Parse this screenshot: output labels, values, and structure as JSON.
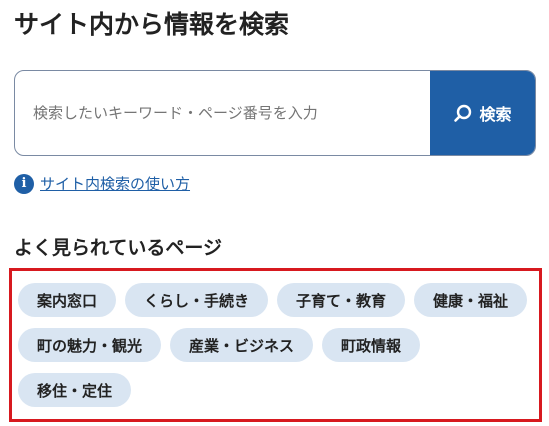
{
  "page": {
    "title": "サイト内から情報を検索"
  },
  "search": {
    "placeholder": "検索したいキーワード・ページ番号を入力",
    "button_label": "検索",
    "button_icon": "search-icon"
  },
  "help": {
    "icon": "info-icon",
    "icon_glyph": "i",
    "link_text": "サイト内検索の使い方"
  },
  "popular": {
    "heading": "よく見られているページ",
    "tags": [
      "案内窓口",
      "くらし・手続き",
      "子育て・教育",
      "健康・福祉",
      "町の魅力・観光",
      "産業・ビジネス",
      "町政情報",
      "移住・定住"
    ]
  },
  "colors": {
    "accent": "#1f5fa6",
    "tag_background": "#d9e5f2",
    "highlight_border": "#d7191f"
  }
}
